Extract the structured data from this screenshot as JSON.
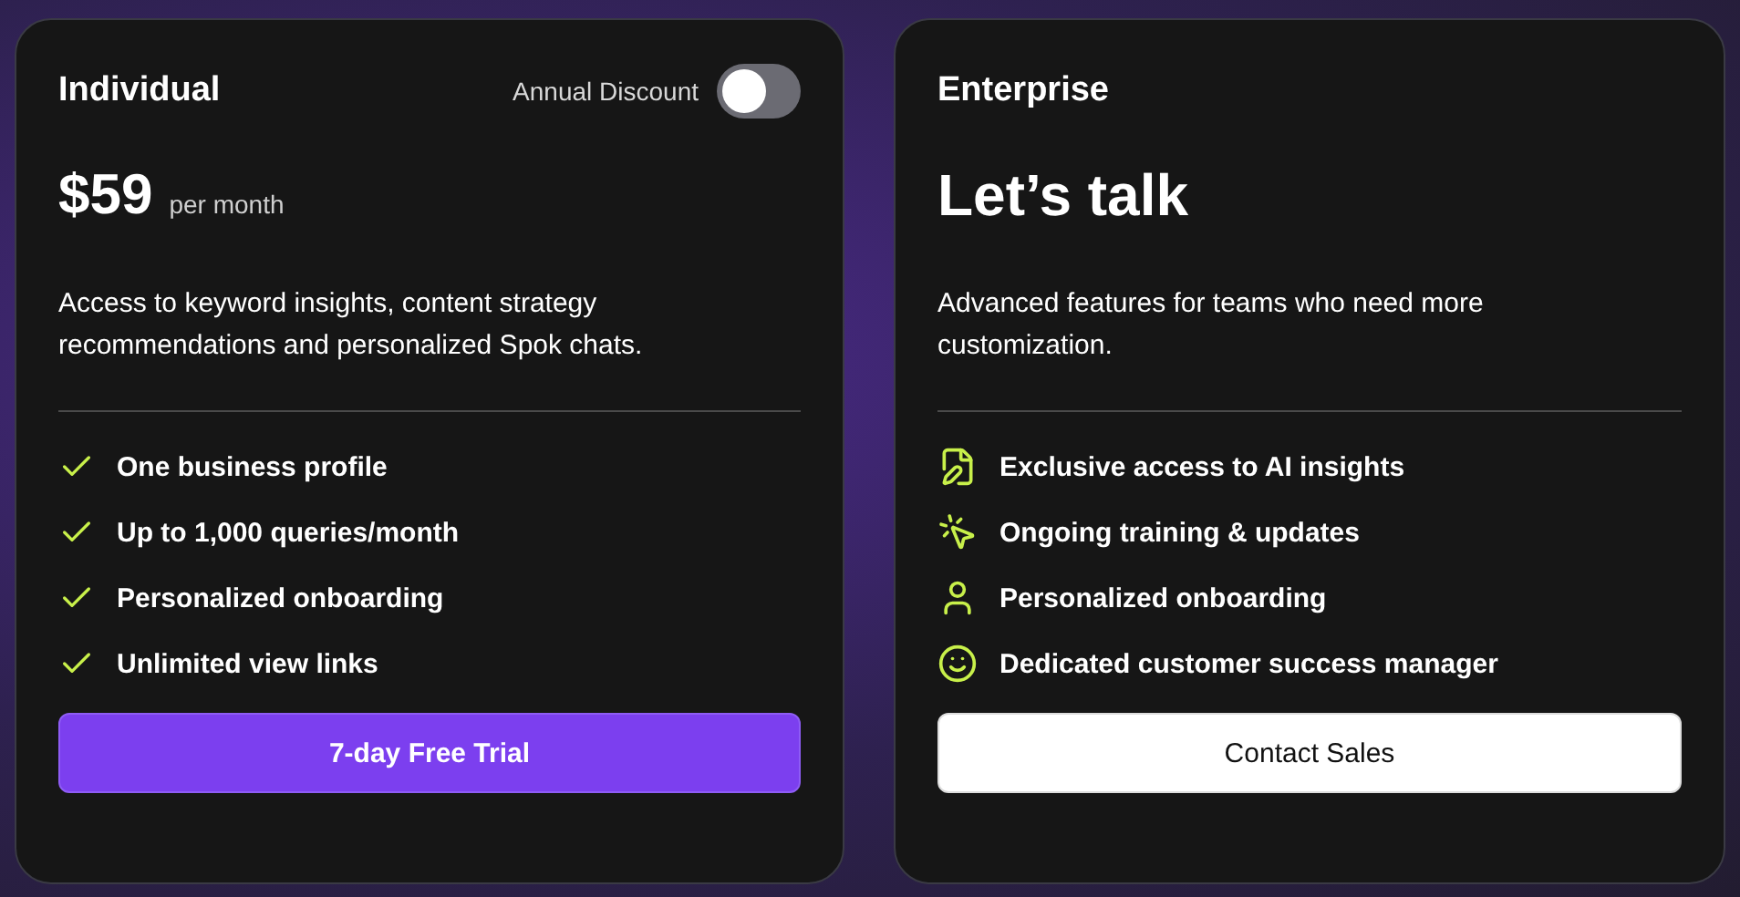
{
  "plans": [
    {
      "name": "Individual",
      "discount": {
        "label": "Annual Discount",
        "on": false
      },
      "price": {
        "amount": "$59",
        "period": "per month"
      },
      "description": "Access to keyword insights, content strategy recommendations and personalized Spok chats.",
      "kind": "checks",
      "features": [
        {
          "text": "One business profile"
        },
        {
          "text": "Up to 1,000 queries/month"
        },
        {
          "text": "Personalized onboarding"
        },
        {
          "text": "Unlimited view links"
        }
      ],
      "button": {
        "kind": "primary",
        "label": "7-day Free Trial"
      }
    },
    {
      "name": "Enterprise",
      "headline": "Let’s talk",
      "description": "Advanced features for teams who need more customization.",
      "kind": "icons",
      "features": [
        {
          "text": "Exclusive access to AI insights"
        },
        {
          "text": "Ongoing training & updates"
        },
        {
          "text": "Personalized onboarding"
        },
        {
          "text": "Dedicated customer success manager"
        }
      ],
      "button": {
        "kind": "light",
        "label": "Contact Sales"
      }
    }
  ]
}
